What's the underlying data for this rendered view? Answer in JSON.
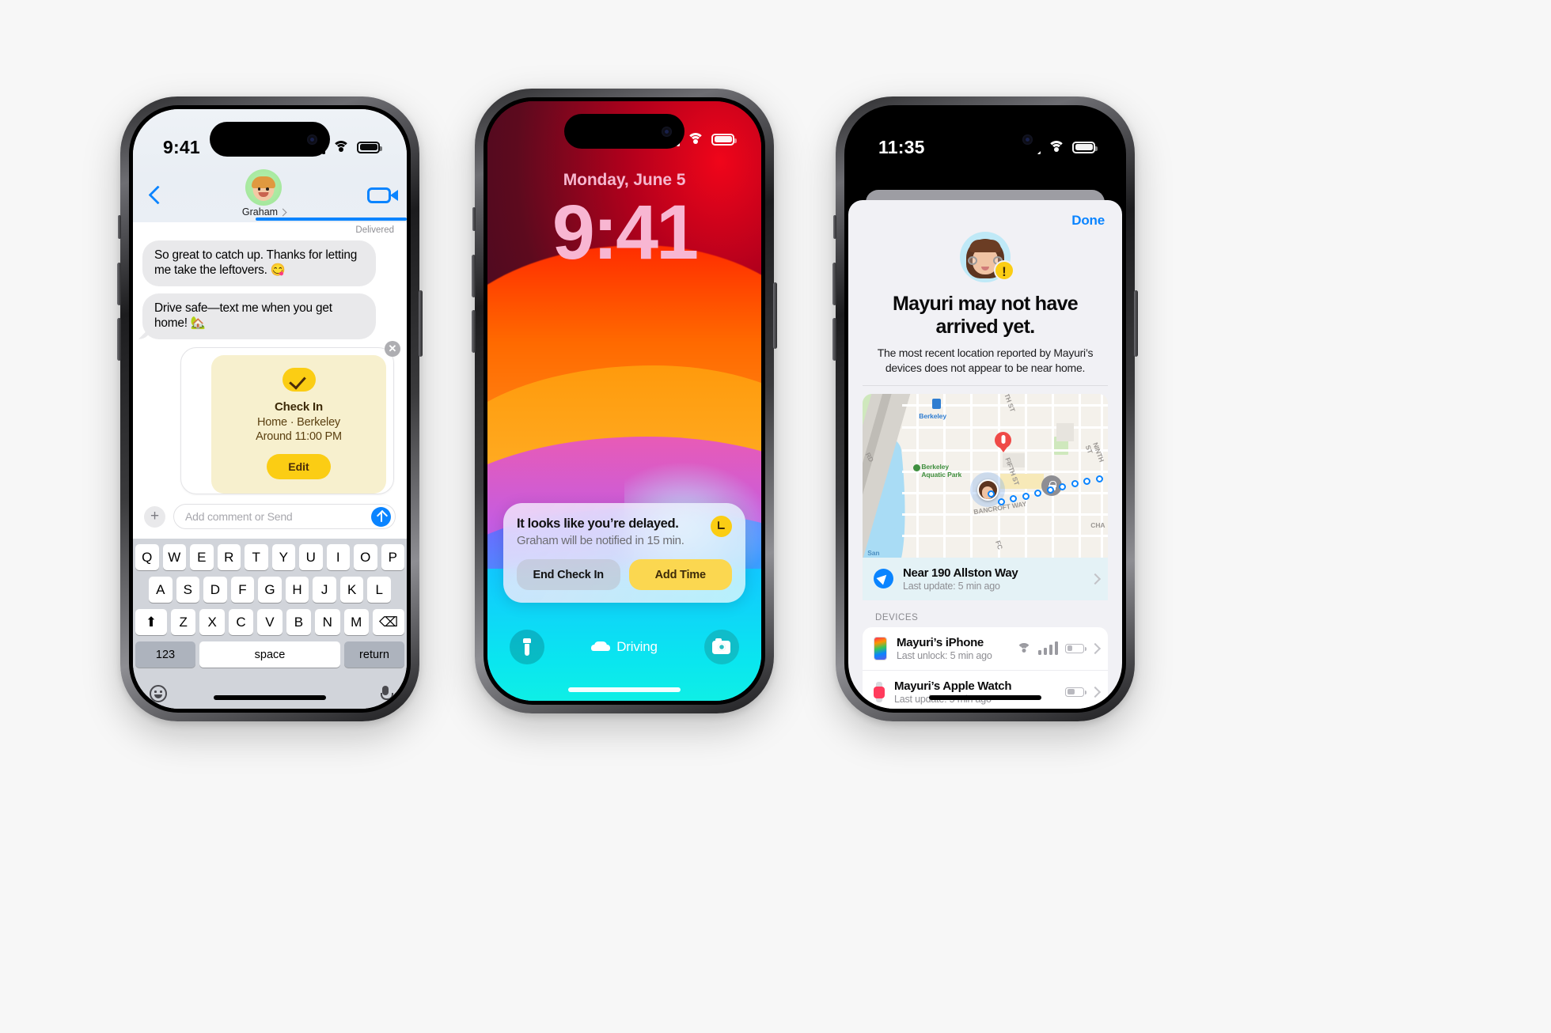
{
  "phone_messages": {
    "status": {
      "time": "9:41",
      "signal_icon": "cellular-bars-icon",
      "wifi_icon": "wifi-icon",
      "battery_icon": "battery-icon"
    },
    "header": {
      "back_icon": "back-chevron-icon",
      "contact_name": "Graham",
      "facetime_icon": "facetime-video-icon",
      "avatar_icon": "memoji-avatar"
    },
    "delivered_label": "Delivered",
    "messages": [
      {
        "text": "So great to catch up. Thanks for letting me take the leftovers. 😋"
      },
      {
        "text": "Drive safe—text me when you get home! 🏡"
      }
    ],
    "checkin_card": {
      "check_icon": "yellow-check-icon",
      "title": "Check In",
      "location": "Home · Berkeley",
      "time": "Around 11:00 PM",
      "edit_label": "Edit",
      "close_icon": "close-x-icon"
    },
    "composer": {
      "plus_icon": "plus-icon",
      "placeholder": "Add comment or Send",
      "send_icon": "send-arrow-icon"
    },
    "keyboard": {
      "row1": [
        "Q",
        "W",
        "E",
        "R",
        "T",
        "Y",
        "U",
        "I",
        "O",
        "P"
      ],
      "row2": [
        "A",
        "S",
        "D",
        "F",
        "G",
        "H",
        "J",
        "K",
        "L"
      ],
      "row3": [
        "Z",
        "X",
        "C",
        "V",
        "B",
        "N",
        "M"
      ],
      "shift_icon": "shift-arrow-icon",
      "delete_icon": "delete-backspace-icon",
      "numbers_label": "123",
      "space_label": "space",
      "return_label": "return",
      "emoji_icon": "emoji-smiley-icon",
      "mic_icon": "microphone-icon"
    }
  },
  "phone_lockscreen": {
    "status": {
      "time": "",
      "signal_icon": "cellular-bars-icon",
      "wifi_icon": "wifi-icon",
      "battery_icon": "battery-icon"
    },
    "date": "Monday, June 5",
    "time": "9:41",
    "notification": {
      "title": "It looks like you’re delayed.",
      "subtitle": "Graham will be notified in 15 min.",
      "badge_icon": "checkin-clock-icon",
      "end_label": "End Check In",
      "add_label": "Add Time"
    },
    "bottom": {
      "flashlight_icon": "flashlight-icon",
      "focus_label": "Driving",
      "focus_icon": "car-icon",
      "camera_icon": "camera-icon"
    }
  },
  "phone_findmy": {
    "status": {
      "time": "11:35",
      "signal_icon": "cellular-bars-icon",
      "wifi_icon": "wifi-icon",
      "battery_icon": "battery-icon"
    },
    "done_label": "Done",
    "avatar_icon": "memoji-avatar",
    "alert_badge": "!",
    "title": "Mayuri may not have arrived yet.",
    "description": "The most recent location reported by Mayuri’s devices does not appear to be near home.",
    "map": {
      "labels": [
        {
          "text": "Berkeley",
          "kind": "transit"
        },
        {
          "text": "Berkeley\nAquatic Park",
          "kind": "park"
        },
        {
          "text": "FIFTH ST",
          "kind": "street"
        },
        {
          "text": "NINTH ST",
          "kind": "street"
        },
        {
          "text": "BANCROFT WAY",
          "kind": "street"
        },
        {
          "text": "RD",
          "kind": "street"
        },
        {
          "text": "CHA",
          "kind": "street"
        },
        {
          "text": "San",
          "kind": "water"
        },
        {
          "text": "FC",
          "kind": "street"
        },
        {
          "text": "TH ST",
          "kind": "street"
        }
      ],
      "pin_icon": "destination-pin-icon",
      "person_icon": "person-location-icon",
      "home_icon": "home-lock-icon",
      "route_icon": "route-dots-icon"
    },
    "location_row": {
      "icon": "navigation-arrow-icon",
      "title": "Near 190 Allston Way",
      "subtitle": "Last update: 5 min ago",
      "chevron_icon": "chevron-right-icon"
    },
    "devices_header": "DEVICES",
    "devices": [
      {
        "icon": "iphone-icon",
        "name": "Mayuri’s iPhone",
        "subtitle": "Last unlock: 5 min ago",
        "wifi_icon": "wifi-icon",
        "signal_icon": "cellular-bars-icon",
        "battery_icon": "battery-icon",
        "chevron_icon": "chevron-right-icon"
      },
      {
        "icon": "apple-watch-icon",
        "name": "Mayuri’s Apple Watch",
        "subtitle": "Last update: 5 min ago",
        "battery_icon": "battery-icon",
        "chevron_icon": "chevron-right-icon"
      }
    ]
  },
  "colors": {
    "accent_blue": "#0a84ff",
    "checkin_yellow": "#fbcd14",
    "bubble_grey": "#e9e9eb",
    "page_bg": "#f7f7f7"
  }
}
